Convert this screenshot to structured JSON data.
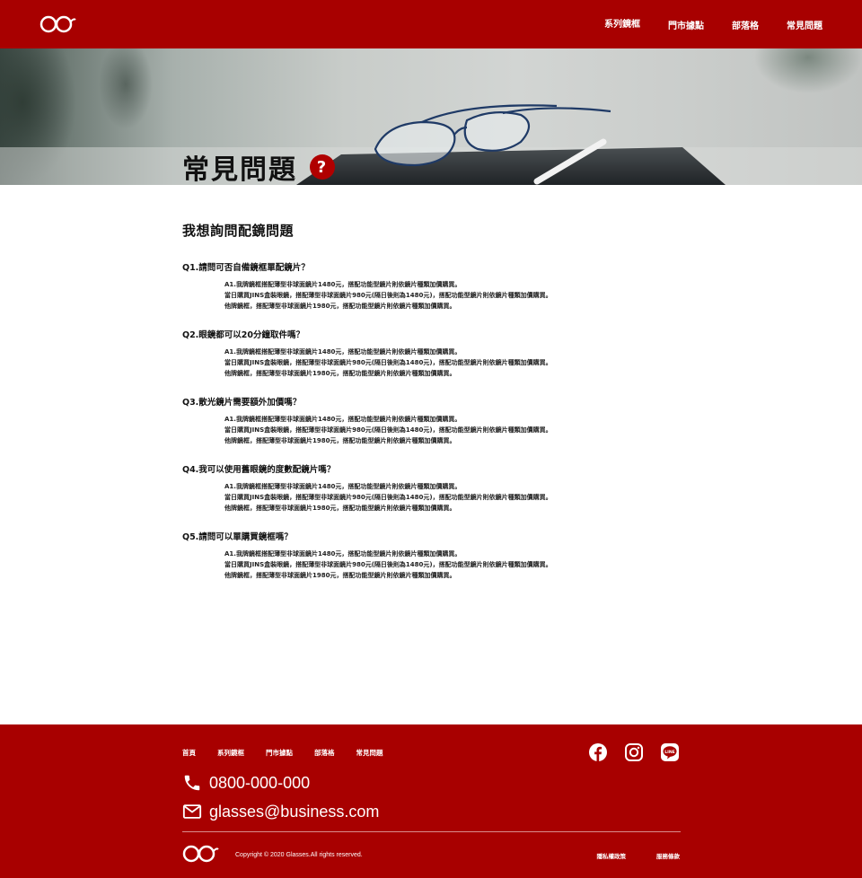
{
  "header": {
    "nav": [
      "系列鏡框",
      "門市據點",
      "部落格",
      "常見問題"
    ]
  },
  "hero": {
    "title": "常見問題",
    "badge": "?"
  },
  "faq": {
    "section_title": "我想詢問配鏡問題",
    "items": [
      {
        "question": "Q1.請問可否自備鏡框單配鏡片？",
        "answer": [
          "A1.我牌鏡框搭配薄型非球面鏡片1480元，搭配功能型鏡片則依鏡片種類加價購買。",
          "當日購買JINS盒裝眼鏡，搭配薄型非球面鏡片980元(隔日後則為1480元)，搭配功能型鏡片則依鏡片種類加價購買。",
          "他牌鏡框，搭配薄型非球面鏡片1980元，搭配功能型鏡片則依鏡片種類加價購買。"
        ]
      },
      {
        "question": "Q2.眼鏡都可以20分鐘取件嗎？",
        "answer": [
          "A1.我牌鏡框搭配薄型非球面鏡片1480元，搭配功能型鏡片則依鏡片種類加價購買。",
          "當日購買JINS盒裝眼鏡，搭配薄型非球面鏡片980元(隔日後則為1480元)，搭配功能型鏡片則依鏡片種類加價購買。",
          "他牌鏡框，搭配薄型非球面鏡片1980元，搭配功能型鏡片則依鏡片種類加價購買。"
        ]
      },
      {
        "question": "Q3.散光鏡片需要額外加價嗎？",
        "answer": [
          "A1.我牌鏡框搭配薄型非球面鏡片1480元，搭配功能型鏡片則依鏡片種類加價購買。",
          "當日購買JINS盒裝眼鏡，搭配薄型非球面鏡片980元(隔日後則為1480元)，搭配功能型鏡片則依鏡片種類加價購買。",
          "他牌鏡框，搭配薄型非球面鏡片1980元，搭配功能型鏡片則依鏡片種類加價購買。"
        ]
      },
      {
        "question": "Q4.我可以使用舊眼鏡的度數配鏡片嗎？",
        "answer": [
          "A1.我牌鏡框搭配薄型非球面鏡片1480元，搭配功能型鏡片則依鏡片種類加價購買。",
          "當日購買JINS盒裝眼鏡，搭配薄型非球面鏡片980元(隔日後則為1480元)，搭配功能型鏡片則依鏡片種類加價購買。",
          "他牌鏡框，搭配薄型非球面鏡片1980元，搭配功能型鏡片則依鏡片種類加價購買。"
        ]
      },
      {
        "question": "Q5.請問可以單購買鏡框嗎？",
        "answer": [
          "A1.我牌鏡框搭配薄型非球面鏡片1480元，搭配功能型鏡片則依鏡片種類加價購買。",
          "當日購買JINS盒裝眼鏡，搭配薄型非球面鏡片980元(隔日後則為1480元)，搭配功能型鏡片則依鏡片種類加價購買。",
          "他牌鏡框，搭配薄型非球面鏡片1980元，搭配功能型鏡片則依鏡片種類加價購買。"
        ]
      }
    ]
  },
  "footer": {
    "links": [
      "首頁",
      "系列鏡框",
      "門市據點",
      "部落格",
      "常見問題"
    ],
    "socials": [
      "facebook-icon",
      "instagram-icon",
      "line-icon"
    ],
    "phone": "0800-000-000",
    "email": "glasses@business.com",
    "copyright": "Copyright © 2020 Glasses.All rights reserved.",
    "legal": [
      "隱私權政策",
      "服務條款"
    ]
  },
  "colors": {
    "brand_red": "#a80000",
    "badge_red": "#b00000"
  }
}
